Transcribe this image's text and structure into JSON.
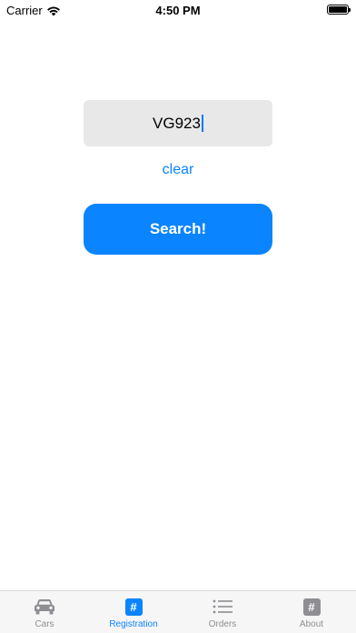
{
  "status_bar": {
    "carrier": "Carrier",
    "time": "4:50 PM"
  },
  "search": {
    "value": "VG923"
  },
  "clear_label": "clear",
  "search_button_label": "Search!",
  "tabs": [
    {
      "label": "Cars",
      "icon": "car-icon"
    },
    {
      "label": "Registration",
      "icon": "hash-icon",
      "selected": true
    },
    {
      "label": "Orders",
      "icon": "list-icon"
    },
    {
      "label": "About",
      "icon": "hash-icon"
    }
  ],
  "colors": {
    "accent": "#0a84ff",
    "inactive": "#8e8e93",
    "field_bg": "#e8e8e8"
  }
}
